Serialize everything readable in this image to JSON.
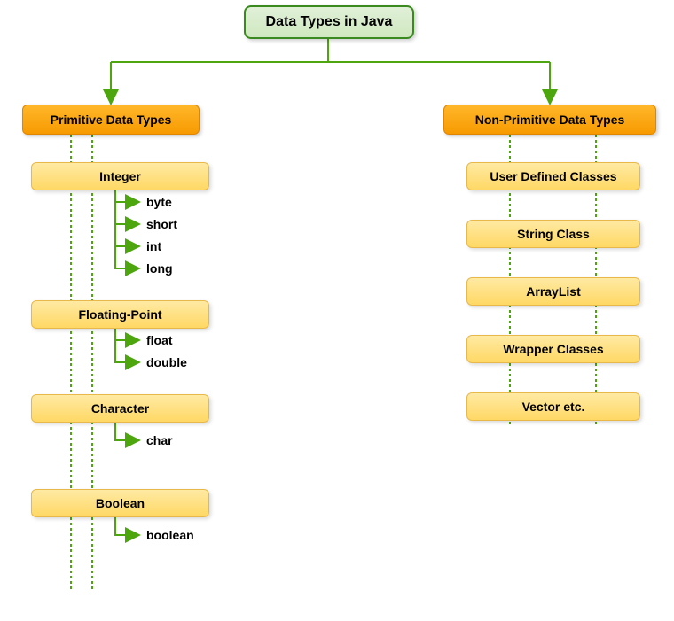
{
  "root": {
    "title": "Data Types in Java"
  },
  "primitive": {
    "title": "Primitive Data Types",
    "groups": [
      {
        "label": "Integer",
        "items": [
          "byte",
          "short",
          "int",
          "long"
        ]
      },
      {
        "label": "Floating-Point",
        "items": [
          "float",
          "double"
        ]
      },
      {
        "label": "Character",
        "items": [
          "char"
        ]
      },
      {
        "label": "Boolean",
        "items": [
          "boolean"
        ]
      }
    ]
  },
  "nonprimitive": {
    "title": "Non-Primitive Data Types",
    "items": [
      "User Defined Classes",
      "String Class",
      "ArrayList",
      "Wrapper Classes",
      "Vector etc."
    ]
  }
}
